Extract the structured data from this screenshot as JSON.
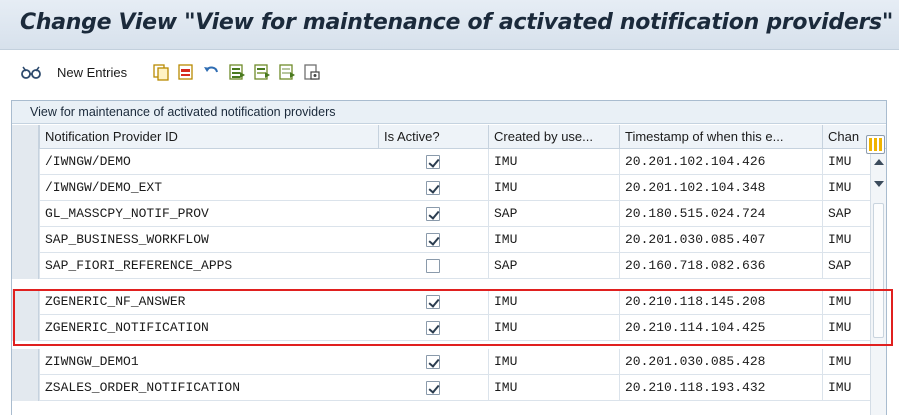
{
  "window": {
    "title": "Change View \"View for maintenance of activated notification providers\""
  },
  "toolbar": {
    "new_entries_label": "New Entries",
    "icons": [
      "glasses-icon",
      "copy-icon",
      "delete-icon",
      "undo-icon",
      "select-all-icon",
      "select-block-icon",
      "deselect-all-icon",
      "print-icon"
    ]
  },
  "table": {
    "title": "View for maintenance of activated notification providers",
    "columns": [
      "Notification Provider ID",
      "Is Active?",
      "Created by use...",
      "Timestamp of when this e...",
      "Chan"
    ],
    "rows": [
      {
        "id": "/IWNGW/DEMO",
        "active": true,
        "created_by": "IMU",
        "timestamp": "20.201.102.104.426",
        "changed": "IMU"
      },
      {
        "id": "/IWNGW/DEMO_EXT",
        "active": true,
        "created_by": "IMU",
        "timestamp": "20.201.102.104.348",
        "changed": "IMU"
      },
      {
        "id": "GL_MASSCPY_NOTIF_PROV",
        "active": true,
        "created_by": "SAP",
        "timestamp": "20.180.515.024.724",
        "changed": "SAP"
      },
      {
        "id": "SAP_BUSINESS_WORKFLOW",
        "active": true,
        "created_by": "IMU",
        "timestamp": "20.201.030.085.407",
        "changed": "IMU"
      },
      {
        "id": "SAP_FIORI_REFERENCE_APPS",
        "active": false,
        "created_by": "SAP",
        "timestamp": "20.160.718.082.636",
        "changed": "SAP"
      },
      {
        "id": "ZGENERIC_NF_ANSWER",
        "active": true,
        "created_by": "IMU",
        "timestamp": "20.210.118.145.208",
        "changed": "IMU"
      },
      {
        "id": "ZGENERIC_NOTIFICATION",
        "active": true,
        "created_by": "IMU",
        "timestamp": "20.210.114.104.425",
        "changed": "IMU"
      },
      {
        "id": "ZIWNGW_DEMO1",
        "active": true,
        "created_by": "IMU",
        "timestamp": "20.201.030.085.428",
        "changed": "IMU"
      },
      {
        "id": "ZSALES_ORDER_NOTIFICATION",
        "active": true,
        "created_by": "IMU",
        "timestamp": "20.210.118.193.432",
        "changed": "IMU"
      }
    ]
  },
  "colors": {
    "highlight": "#e0201f",
    "accent": "#f0b400",
    "header_bg": "#eef3f8"
  }
}
